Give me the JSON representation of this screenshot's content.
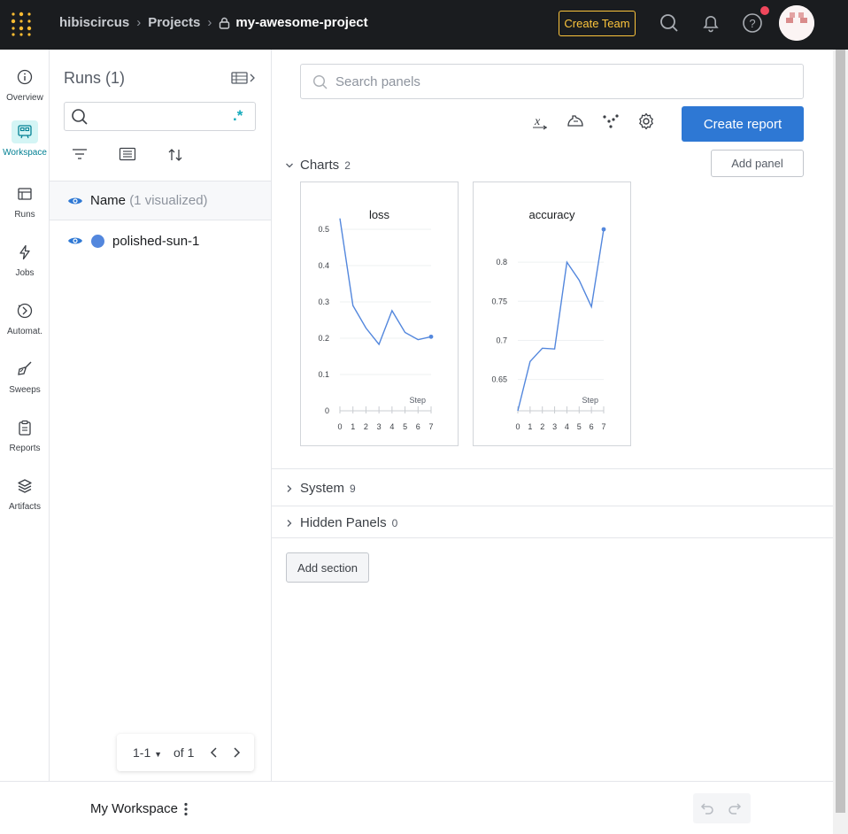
{
  "topbar": {
    "entity": "hibiscircus",
    "projects": "Projects",
    "project": "my-awesome-project",
    "create_team": "Create Team"
  },
  "leftnav": {
    "items": [
      {
        "label": "Overview",
        "icon": "info-icon"
      },
      {
        "label": "Workspace",
        "icon": "workspace-icon",
        "active": true
      },
      {
        "label": "Runs",
        "icon": "table-icon"
      },
      {
        "label": "Jobs",
        "icon": "lightning-icon"
      },
      {
        "label": "Automat.",
        "icon": "automation-icon"
      },
      {
        "label": "Sweeps",
        "icon": "broom-icon"
      },
      {
        "label": "Reports",
        "icon": "clipboard-icon"
      },
      {
        "label": "Artifacts",
        "icon": "layers-icon"
      }
    ]
  },
  "runs": {
    "title": "Runs (1)",
    "regex_label": ".*",
    "header_name": "Name",
    "header_sub": "(1 visualized)",
    "rows": [
      {
        "name": "polished-sun-1",
        "color": "#5387dd"
      }
    ],
    "pager": {
      "range": "1-1",
      "of": "of 1"
    }
  },
  "main": {
    "search_placeholder": "Search panels",
    "create_report": "Create report",
    "add_panel": "Add panel",
    "sections": [
      {
        "title": "Charts",
        "count": "2",
        "expanded": true
      },
      {
        "title": "System",
        "count": "9",
        "expanded": false
      },
      {
        "title": "Hidden Panels",
        "count": "0",
        "expanded": false
      }
    ],
    "add_section": "Add section"
  },
  "footer": {
    "workspace": "My Workspace"
  },
  "chart_data": [
    {
      "type": "line",
      "title": "loss",
      "xlabel": "Step",
      "ylabel": "",
      "x": [
        0,
        1,
        2,
        3,
        4,
        5,
        6,
        7
      ],
      "series": [
        {
          "values": [
            0.53,
            0.29,
            0.228,
            0.183,
            0.276,
            0.216,
            0.196,
            0.204
          ],
          "color": "#5387dd"
        }
      ],
      "xlim": [
        0,
        7
      ],
      "ylim": [
        0,
        0.5
      ],
      "yticks": [
        0,
        0.1,
        0.2,
        0.3,
        0.4,
        0.5
      ],
      "ytick_labels": [
        "0",
        "0.1",
        "0.2",
        "0.3",
        "0.4",
        "0.5"
      ]
    },
    {
      "type": "line",
      "title": "accuracy",
      "xlabel": "Step",
      "ylabel": "",
      "x": [
        0,
        1,
        2,
        3,
        4,
        5,
        6,
        7
      ],
      "series": [
        {
          "values": [
            0.61,
            0.673,
            0.69,
            0.689,
            0.8,
            0.777,
            0.743,
            0.842
          ],
          "color": "#5387dd"
        }
      ],
      "xlim": [
        0,
        7
      ],
      "ylim": [
        0.61,
        0.842
      ],
      "yticks": [
        0.65,
        0.7,
        0.75,
        0.8
      ],
      "ytick_labels": [
        "0.65",
        "0.7",
        "0.75",
        "0.8"
      ]
    }
  ]
}
